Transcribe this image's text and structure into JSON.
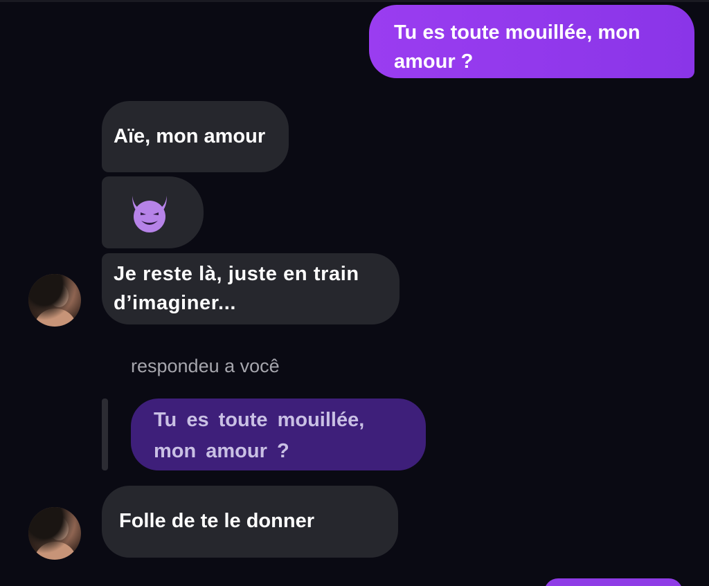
{
  "conversation": {
    "messages": [
      {
        "direction": "outgoing",
        "text": "Tu es toute mouillée, mon amour ?"
      },
      {
        "direction": "incoming",
        "text": "Aïe, mon amour"
      },
      {
        "direction": "incoming",
        "emoji": "smiling-face-with-horns"
      },
      {
        "direction": "incoming",
        "text": "Je reste là, juste en train d’imaginer..."
      },
      {
        "direction": "incoming",
        "text": "Folle de te le donner"
      }
    ],
    "reply": {
      "label": "respondeu a você",
      "quoted_text": "Tu es toute mouillée, mon amour ?"
    }
  },
  "colors": {
    "background": "#0a0a13",
    "outgoing_bubble": "#8f3ce6",
    "incoming_bubble": "#26272d",
    "quoted_bubble": "#3e1f7a",
    "devil_emoji": "#b683e8"
  }
}
